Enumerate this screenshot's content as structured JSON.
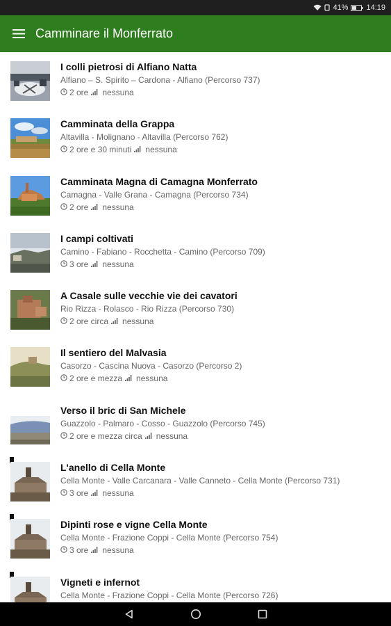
{
  "status_bar": {
    "battery": "41%",
    "time": "14:19"
  },
  "app_bar": {
    "title": "Camminare il Monferrato",
    "menu_icon": "hamburger-menu-icon"
  },
  "colors": {
    "primary": "#2e7d1e",
    "status_bar": "#1f1f1f",
    "nav_bar": "#000000"
  },
  "routes": [
    {
      "title": "I colli pietrosi di Alfiano Natta",
      "route": "Alfiano – S. Spirito – Cardona - Alfiano (Percorso 737)",
      "duration": "2 ore",
      "difficulty": "nessuna",
      "bookmarked": false
    },
    {
      "title": "Camminata della Grappa",
      "route": "Altavilla - Molignano - Altavilla (Percorso 762)",
      "duration": "2 ore e 30 minuti",
      "difficulty": "nessuna",
      "bookmarked": false
    },
    {
      "title": "Camminata Magna di Camagna Monferrato",
      "route": "Camagna - Valle Grana - Camagna (Percorso 734)",
      "duration": "2 ore",
      "difficulty": "nessuna",
      "bookmarked": false
    },
    {
      "title": "I campi coltivati",
      "route": "Camino - Fabiano - Rocchetta - Camino (Percorso 709)",
      "duration": "3 ore",
      "difficulty": "nessuna",
      "bookmarked": false
    },
    {
      "title": "A Casale sulle vecchie vie dei cavatori",
      "route": "Rio Rizza - Rolasco - Rio Rizza (Percorso 730)",
      "duration": "2 ore circa",
      "difficulty": "nessuna",
      "bookmarked": false
    },
    {
      "title": "Il sentiero del Malvasia",
      "route": "Casorzo - Cascina Nuova - Casorzo (Percorso 2)",
      "duration": "2 ore e mezza",
      "difficulty": "nessuna",
      "bookmarked": false
    },
    {
      "title": "Verso il bric di San Michele",
      "route": "Guazzolo - Palmaro - Cosso - Guazzolo (Percorso 745)",
      "duration": "2 ore e mezza circa",
      "difficulty": "nessuna",
      "bookmarked": false
    },
    {
      "title": "L'anello di Cella Monte",
      "route": "Cella Monte - Valle Carcanara - Valle Canneto - Cella Monte (Percorso 731)",
      "duration": "3 ore",
      "difficulty": "nessuna",
      "bookmarked": true
    },
    {
      "title": "Dipinti rose e vigne Cella Monte",
      "route": "Cella Monte - Frazione Coppi - Cella Monte (Percorso 754)",
      "duration": "3 ore",
      "difficulty": "nessuna",
      "bookmarked": true
    },
    {
      "title": "Vigneti e infernot",
      "route": "Cella Monte - Frazione Coppi - Cella Monte (Percorso 726)",
      "duration": "",
      "difficulty": "",
      "bookmarked": true
    }
  ],
  "nav_bar": {
    "back_icon": "back-triangle-icon",
    "home_icon": "home-circle-icon",
    "recents_icon": "recents-square-icon"
  }
}
